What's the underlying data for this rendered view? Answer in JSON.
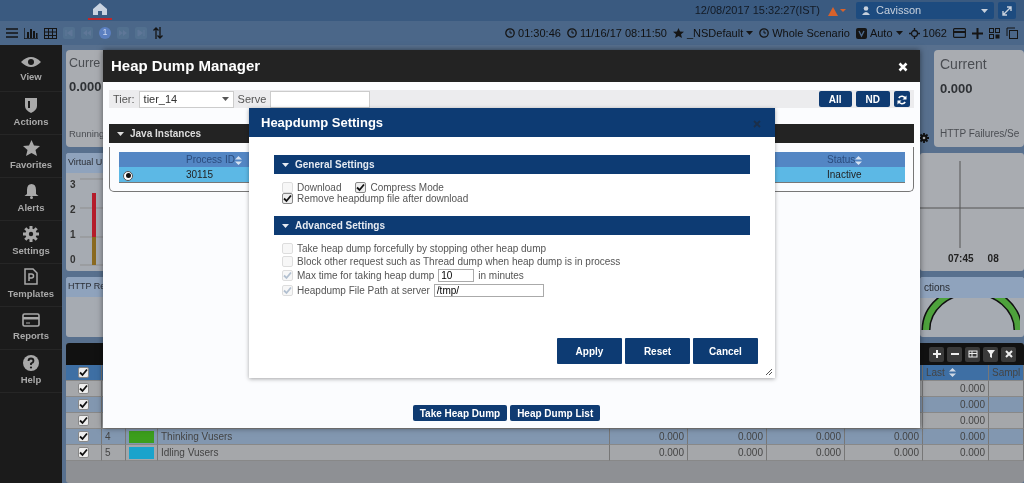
{
  "top_bar": {
    "datetime": "12/08/2017 15:32:27(IST)",
    "user": "Cavisson"
  },
  "toolbar": {
    "page": "1",
    "elapsed": "01:30:46",
    "start_time": "11/16/17 08:11:50",
    "favorite": "_NSDefault",
    "scope": "Whole Scenario",
    "mode": "Auto",
    "count": "1062"
  },
  "sidebar": {
    "items": [
      {
        "label": "View"
      },
      {
        "label": "Actions"
      },
      {
        "label": "Favorites"
      },
      {
        "label": "Alerts"
      },
      {
        "label": "Settings"
      },
      {
        "label": "Templates"
      },
      {
        "label": "Reports"
      },
      {
        "label": "Help"
      }
    ]
  },
  "dashboard": {
    "left_card": {
      "title": "Curre",
      "value": "0.000",
      "caption": "Running"
    },
    "right_card": {
      "title": "Current",
      "value": "0.000",
      "caption": "HTTP Failures/Se"
    },
    "left_chart": {
      "title": "Virtual U",
      "y_ticks": [
        "3",
        "2",
        "1",
        "0"
      ]
    },
    "right_chart": {
      "x_labels": [
        "07:45",
        "08"
      ]
    },
    "left_panel": {
      "title": "HTTP Re"
    },
    "right_panel": {
      "title": "ctions"
    },
    "table": {
      "header_checked": true,
      "columns": [
        "Last",
        "Sampl"
      ],
      "rows": [
        {
          "checked": true,
          "values": [
            "0.000"
          ]
        },
        {
          "checked": true,
          "values": [
            "0.000"
          ]
        },
        {
          "checked": true,
          "values": [
            "0.000"
          ]
        },
        {
          "checked": true,
          "number": "4",
          "color": "#3c9e1c",
          "name": "Thinking Vusers",
          "values": [
            "0.000",
            "0.000",
            "0.000",
            "0.000",
            "0.000"
          ]
        },
        {
          "checked": true,
          "number": "5",
          "color": "#1aa3cc",
          "name": "Idling Vusers",
          "values": [
            "0.000",
            "0.000",
            "0.000",
            "0.000",
            "0.000"
          ]
        }
      ]
    }
  },
  "heap_dump_manager": {
    "title": "Heap Dump Manager",
    "tier_label": "Tier:",
    "tier": "tier_14",
    "server_label": "Serve",
    "buttons": [
      "All",
      "ND"
    ],
    "section": "Java Instances",
    "columns": [
      "Process ID",
      "Status"
    ],
    "rows": [
      {
        "selected": true,
        "process_id": "30115",
        "status": "Inactive"
      }
    ],
    "actions": [
      "Take Heap Dump",
      "Heap Dump List"
    ]
  },
  "heapdump_settings": {
    "title": "Heapdump Settings",
    "sections": [
      {
        "title": "General Settings",
        "expanded": true,
        "rows": [
          {
            "options": [
              {
                "label": "Download",
                "checked": false,
                "disabled": true
              },
              {
                "label": "Compress Mode",
                "checked": true,
                "disabled": false
              }
            ]
          },
          {
            "options": [
              {
                "label": "Remove heapdump file after download",
                "checked": true,
                "disabled": false
              }
            ]
          }
        ]
      },
      {
        "title": "Advanced Settings",
        "expanded": true,
        "rows": [
          {
            "options": [
              {
                "label": "Take heap dump forcefully by stopping other heap dump",
                "checked": false,
                "disabled": true
              }
            ]
          },
          {
            "options": [
              {
                "label": "Block other request such as Thread dump when heap dump is in process",
                "checked": false,
                "disabled": true
              }
            ]
          },
          {
            "options": [
              {
                "label": "Max time for taking heap dump",
                "checked": true,
                "disabled": true,
                "field": "10",
                "suffix": "in minutes"
              }
            ]
          },
          {
            "options": [
              {
                "label": "Heapdump File Path at server",
                "checked": true,
                "disabled": true,
                "field": "/tmp/"
              }
            ]
          }
        ]
      }
    ],
    "buttons": [
      "Apply",
      "Reset",
      "Cancel"
    ]
  }
}
